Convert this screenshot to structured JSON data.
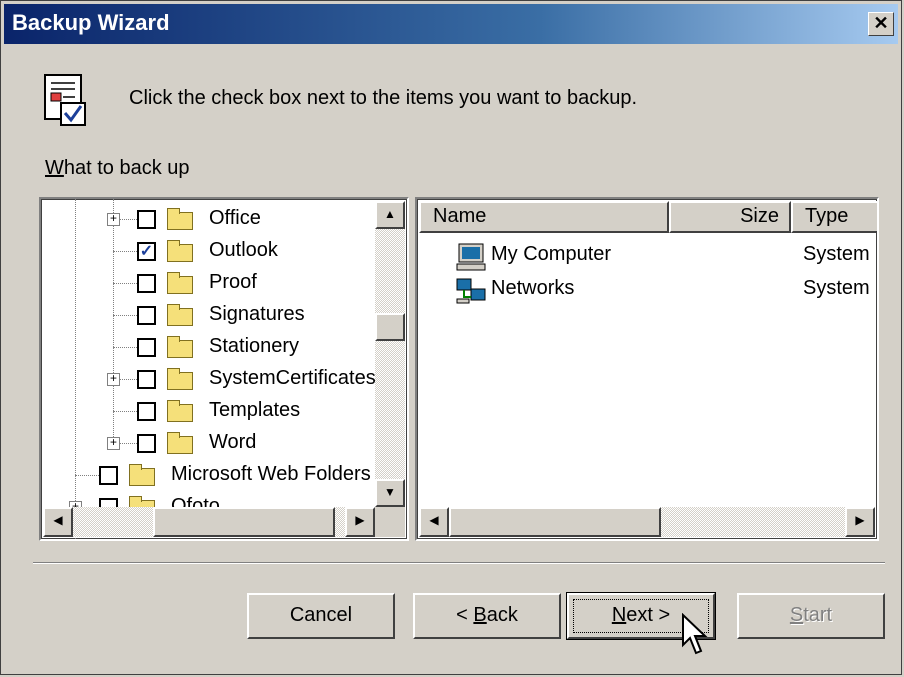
{
  "window": {
    "title": "Backup Wizard",
    "close_glyph": "✕"
  },
  "header": {
    "instruction": "Click the check box next to the items you want to backup.",
    "icon": "backup-checklist-icon"
  },
  "tree": {
    "label_accel": "W",
    "label_rest": "hat to back up",
    "items": [
      {
        "label": "Office",
        "checked": false,
        "expandable": true
      },
      {
        "label": "Outlook",
        "checked": true,
        "expandable": false
      },
      {
        "label": "Proof",
        "checked": false,
        "expandable": false
      },
      {
        "label": "Signatures",
        "checked": false,
        "expandable": false
      },
      {
        "label": "Stationery",
        "checked": false,
        "expandable": false
      },
      {
        "label": "SystemCertificates",
        "checked": false,
        "expandable": true
      },
      {
        "label": "Templates",
        "checked": false,
        "expandable": false
      },
      {
        "label": "Word",
        "checked": false,
        "expandable": true
      },
      {
        "label": "Microsoft Web Folders",
        "checked": false,
        "expandable": false
      },
      {
        "label": "Ofoto",
        "checked": false,
        "expandable": true
      }
    ],
    "check_mark": "✓",
    "plus": "+"
  },
  "list": {
    "columns": {
      "name": "Name",
      "size": "Size",
      "type": "Type"
    },
    "rows": [
      {
        "name": "My Computer",
        "type": "System",
        "icon": "computer-icon"
      },
      {
        "name": "Networks",
        "type": "System",
        "icon": "network-icon"
      }
    ]
  },
  "scroll": {
    "up": "▲",
    "down": "▼",
    "left": "◀",
    "right": "▶"
  },
  "buttons": {
    "cancel": "Cancel",
    "back_prefix": "< ",
    "back_accel": "B",
    "back_rest": "ack",
    "next_accel": "N",
    "next_rest": "ext >",
    "start_accel": "S",
    "start_rest": "tart"
  },
  "colors": {
    "title_start": "#0a246a",
    "title_end": "#a6caf0",
    "face": "#d4d0c8",
    "check": "#1c3f9a"
  }
}
